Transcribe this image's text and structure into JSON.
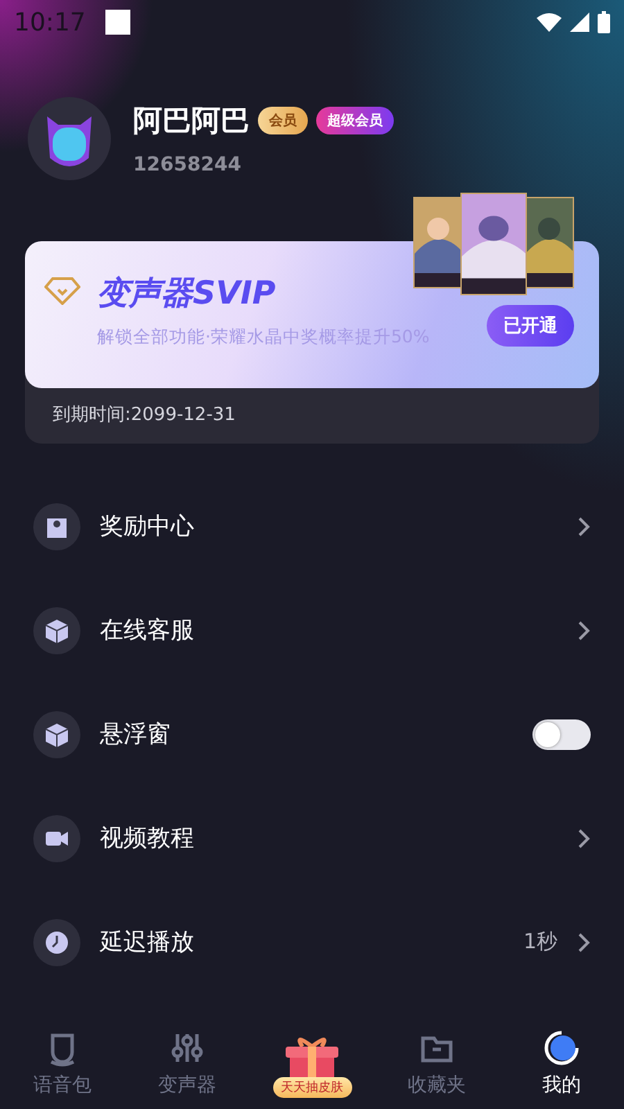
{
  "status_bar": {
    "time": "10:17"
  },
  "profile": {
    "name": "阿巴阿巴",
    "badges": [
      {
        "kind": "member",
        "label": "会员"
      },
      {
        "kind": "super",
        "label": "超级会员"
      }
    ],
    "user_id": "12658244"
  },
  "vip_card": {
    "title": "变声器SVIP",
    "subtitle": "解锁全部功能·荣耀水晶中奖概率提升50%",
    "button": "已开通",
    "expiry": "到期时间:2099-12-31"
  },
  "menu": [
    {
      "kind": "arrow",
      "label": "奖励中心"
    },
    {
      "kind": "arrow",
      "label": "在线客服"
    },
    {
      "kind": "toggle",
      "label": "悬浮窗",
      "on": false
    },
    {
      "kind": "arrow",
      "label": "视频教程"
    },
    {
      "kind": "value",
      "label": "延迟播放",
      "value": "1秒"
    }
  ],
  "tabs": [
    {
      "kind": "tab",
      "label": "语音包",
      "selected": false
    },
    {
      "kind": "tab",
      "label": "变声器",
      "selected": false
    },
    {
      "kind": "promo",
      "label": "天天抽皮肤"
    },
    {
      "kind": "tab",
      "label": "收藏夹",
      "selected": false
    },
    {
      "kind": "tab",
      "label": "我的",
      "selected": true
    }
  ]
}
